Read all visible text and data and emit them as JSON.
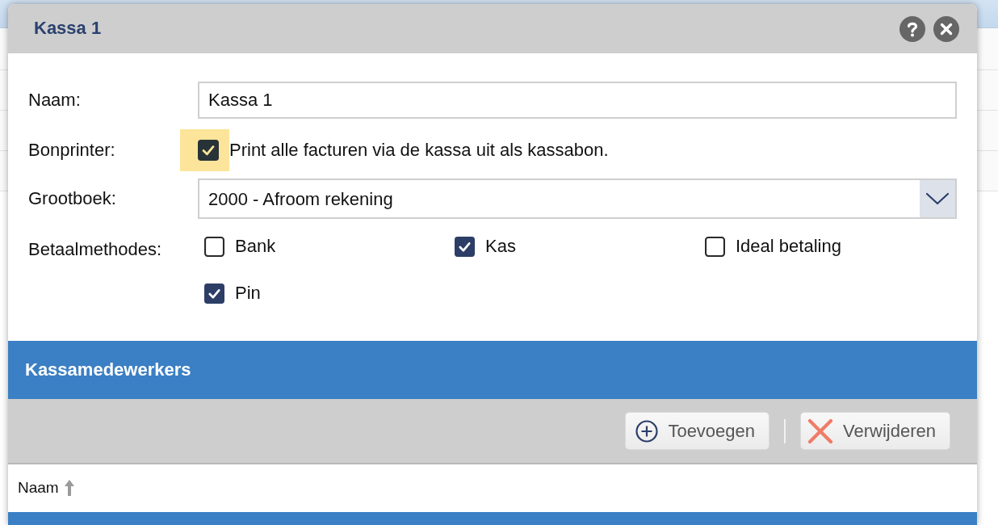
{
  "dialog": {
    "title": "Kassa 1",
    "fields": [
      {
        "kind": "text",
        "label": "Naam:",
        "value": "Kassa 1"
      },
      {
        "kind": "checkbox",
        "label": "Bonprinter:",
        "option": "Print alle facturen via de kassa uit als kassabon.",
        "checked": true,
        "focused": true
      },
      {
        "kind": "select",
        "label": "Grootboek:",
        "value": "2000 - Afroom rekening"
      },
      {
        "kind": "checkbox_group",
        "label": "Betaalmethodes:",
        "options": [
          {
            "label": "Bank",
            "checked": false
          },
          {
            "label": "Kas",
            "checked": true
          },
          {
            "label": "Ideal betaling",
            "checked": false
          },
          {
            "label": "Pin",
            "checked": true
          }
        ]
      }
    ],
    "section": {
      "title": "Kassamedewerkers",
      "toolbar": [
        {
          "kind": "add",
          "label": "Toevoegen"
        },
        {
          "kind": "remove",
          "label": "Verwijderen"
        }
      ],
      "table": {
        "columns": [
          {
            "label": "Naam",
            "sorted": true
          }
        ]
      }
    }
  }
}
